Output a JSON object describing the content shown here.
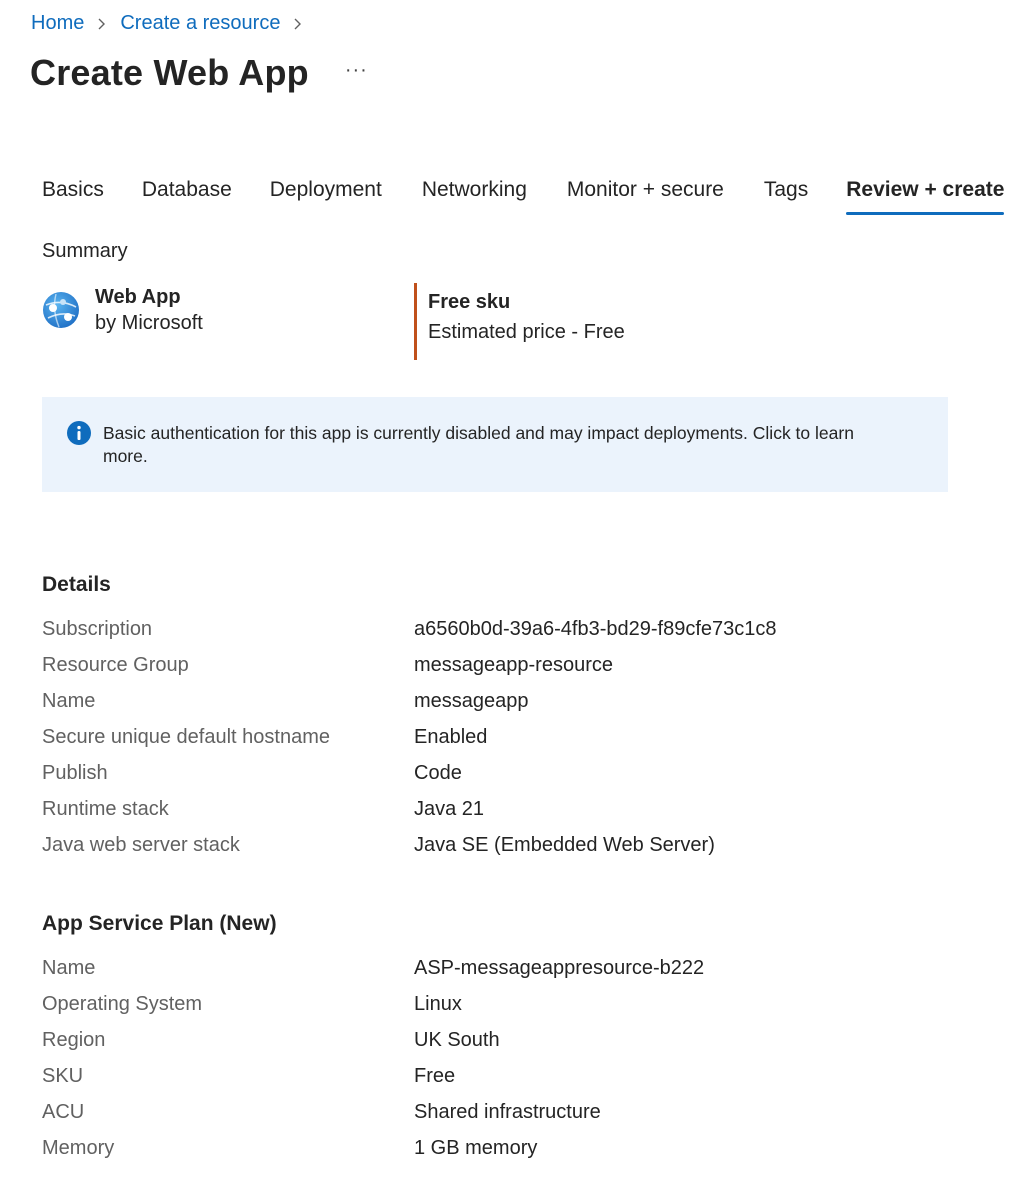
{
  "breadcrumb": {
    "home": "Home",
    "create_resource": "Create a resource"
  },
  "page": {
    "title": "Create Web App",
    "more": "···"
  },
  "tabs": [
    "Basics",
    "Database",
    "Deployment",
    "Networking",
    "Monitor + secure",
    "Tags",
    "Review + create"
  ],
  "active_tab": "Review + create",
  "summary": {
    "label": "Summary",
    "product_name": "Web App",
    "product_vendor": "by Microsoft",
    "pricing_title": "Free sku",
    "pricing_sub": "Estimated price - Free",
    "pricing_accent": "#c0501b"
  },
  "info": {
    "text": "Basic authentication for this app is currently disabled and may impact deployments. Click to learn more.",
    "icon": "info-icon",
    "color": "#0f6cbd"
  },
  "details": {
    "title": "Details",
    "rows": [
      {
        "label": "Subscription",
        "value": "a6560b0d-39a6-4fb3-bd29-f89cfe73c1c8"
      },
      {
        "label": "Resource Group",
        "value": "messageapp-resource"
      },
      {
        "label": "Name",
        "value": "messageapp"
      },
      {
        "label": "Secure unique default hostname",
        "value": "Enabled"
      },
      {
        "label": "Publish",
        "value": "Code"
      },
      {
        "label": "Runtime stack",
        "value": "Java 21"
      },
      {
        "label": "Java web server stack",
        "value": "Java SE (Embedded Web Server)"
      }
    ]
  },
  "plan": {
    "title": "App Service Plan (New)",
    "rows": [
      {
        "label": "Name",
        "value": "ASP-messageappresource-b222"
      },
      {
        "label": "Operating System",
        "value": "Linux"
      },
      {
        "label": "Region",
        "value": "UK South"
      },
      {
        "label": "SKU",
        "value": "Free"
      },
      {
        "label": "ACU",
        "value": "Shared infrastructure"
      },
      {
        "label": "Memory",
        "value": "1 GB memory"
      }
    ]
  },
  "colors": {
    "link": "#0f6cbd",
    "tab_indicator": "#0f6cbd",
    "info_bg": "#ebf3fc"
  }
}
